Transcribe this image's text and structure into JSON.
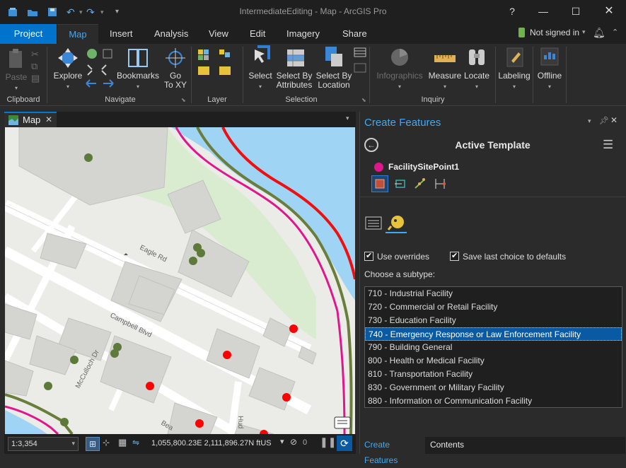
{
  "window": {
    "title": "IntermediateEditing - Map - ArcGIS Pro",
    "help": "?"
  },
  "tabs": {
    "project": "Project",
    "items": [
      "Map",
      "Insert",
      "Analysis",
      "View",
      "Edit",
      "Imagery",
      "Share"
    ],
    "signin": "Not signed in"
  },
  "ribbon": {
    "clipboard": {
      "paste": "Paste",
      "group": "Clipboard"
    },
    "navigate": {
      "explore": "Explore",
      "bookmarks": "Bookmarks",
      "goto_line1": "Go",
      "goto_line2": "To XY",
      "group": "Navigate"
    },
    "layer": {
      "group": "Layer"
    },
    "selection": {
      "select": "Select",
      "by_attr_line1": "Select By",
      "by_attr_line2": "Attributes",
      "by_loc_line1": "Select By",
      "by_loc_line2": "Location",
      "group": "Selection"
    },
    "inquiry": {
      "infographics": "Infographics",
      "measure": "Measure",
      "locate": "Locate",
      "group": "Inquiry"
    },
    "labeling": "Labeling",
    "offline": "Offline"
  },
  "map": {
    "tab_label": "Map",
    "streets": [
      "Eagle Rd",
      "Campbell Blvd",
      "McCulloch Dr",
      "Hud",
      "Bea"
    ],
    "scale": "1:3,354",
    "coords": "1,055,800.23E 2,111,896.27N ftUS",
    "selected_count": "0"
  },
  "create_features": {
    "title": "Create Features",
    "active_template_label": "Active Template",
    "template_name": "FacilitySitePoint1",
    "use_overrides": "Use overrides",
    "save_last_choice": "Save last choice to defaults",
    "choose_subtype": "Choose a subtype:",
    "subtypes": [
      "710 - Industrial Facility",
      "720 - Commercial or Retail Facility",
      "730 - Education Facility",
      "740 - Emergency Response or Law Enforcement Facility",
      "790 - Building General",
      "800 - Health or Medical Facility",
      "810 - Transportation Facility",
      "830 - Government or Military Facility",
      "880 - Information or Communication Facility"
    ],
    "selected_subtype": "740 - Emergency Response or Law Enforcement Facility",
    "bottom_tabs": [
      "Create Features",
      "Contents"
    ]
  },
  "colors": {
    "accent": "#40a9f4",
    "project_tab": "#0074cc",
    "selected_row": "#0a5aa3",
    "template_dot": "#e0168d"
  }
}
